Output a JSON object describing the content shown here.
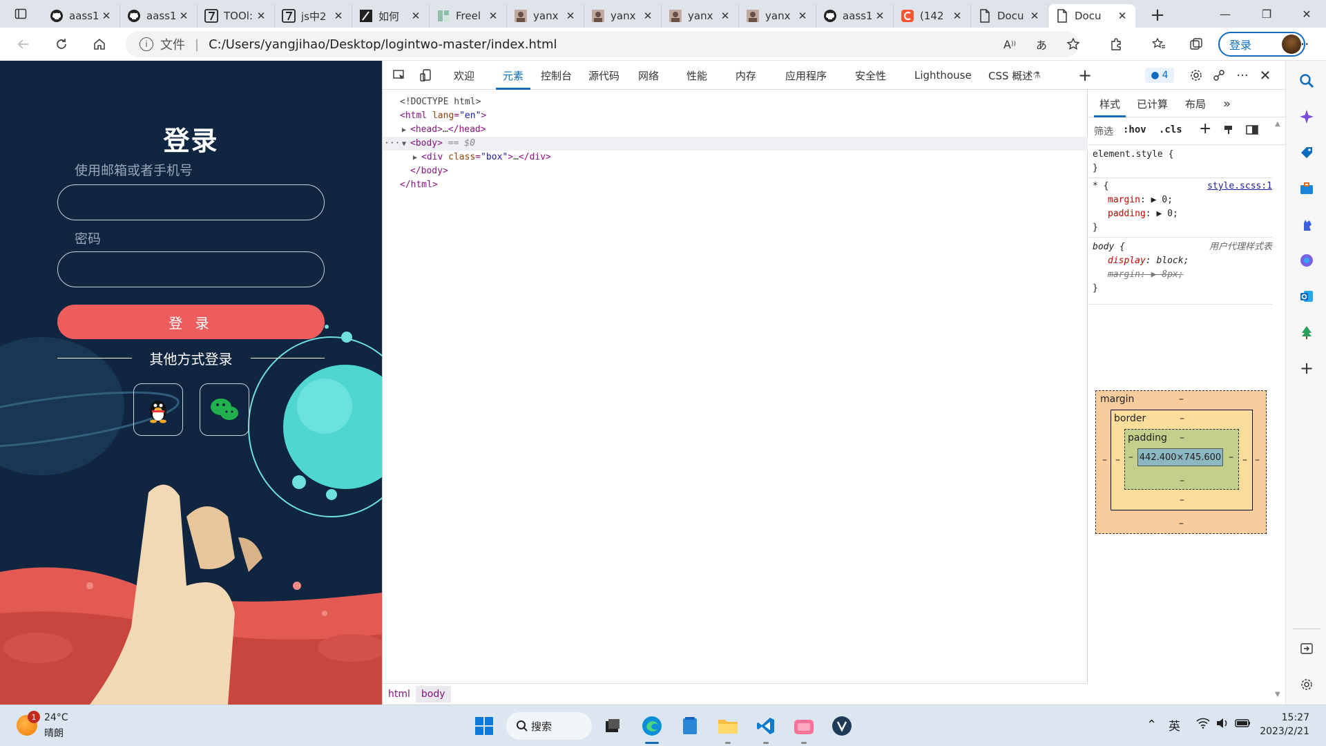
{
  "browser": {
    "tabs": [
      {
        "label": "aass1",
        "icon": "github-icon"
      },
      {
        "label": "aass1",
        "icon": "github-icon"
      },
      {
        "label": "TOOl:",
        "icon": "site-7-icon"
      },
      {
        "label": "js中2",
        "icon": "site-7-icon"
      },
      {
        "label": "如何",
        "icon": "feather-icon"
      },
      {
        "label": "Freel",
        "icon": "freelogo-icon"
      },
      {
        "label": "yanx",
        "icon": "profile-photo-icon"
      },
      {
        "label": "yanx",
        "icon": "profile-photo-icon"
      },
      {
        "label": "yanx",
        "icon": "profile-photo-icon"
      },
      {
        "label": "yanx",
        "icon": "profile-photo-icon"
      },
      {
        "label": "aass1",
        "icon": "github-icon"
      },
      {
        "label": "(142",
        "icon": "csdn-icon"
      },
      {
        "label": "Docu",
        "icon": "document-icon"
      },
      {
        "label": "Docu",
        "icon": "document-icon",
        "active": true
      }
    ],
    "address": {
      "scheme_label": "文件",
      "url": "C:/Users/yangjihao/Desktop/logintwo-master/index.html"
    },
    "profile_button": "登录"
  },
  "login_page": {
    "title": "登录",
    "email_label": "使用邮箱或者手机号",
    "password_label": "密码",
    "submit_label": "登 录",
    "other_login": "其他方式登录"
  },
  "devtools": {
    "tabs": [
      "欢迎",
      "元素",
      "控制台",
      "源代码",
      "网络",
      "性能",
      "内存",
      "应用程序",
      "安全性",
      "Lighthouse",
      "CSS 概述"
    ],
    "selected_tab": "元素",
    "issues_count": "4",
    "dom_lines": {
      "doctype": "<!DOCTYPE html>",
      "html_open_tag": "html",
      "html_lang_attr": "lang",
      "html_lang_value": "\"en\"",
      "head_collapsed": "head",
      "head_ellipsis": "…",
      "body_tag": "body",
      "body_marker": "== $0",
      "div_tag": "div",
      "div_class_attr": "class",
      "div_class_value": "\"box\"",
      "div_ellipsis": "…",
      "body_close": "</body>",
      "html_close": "</html>"
    },
    "breadcrumbs": [
      "html",
      "body"
    ],
    "styles": {
      "tabs": [
        "样式",
        "已计算",
        "布局"
      ],
      "filter_label": "筛选",
      "hov_label": ":hov",
      "cls_label": ".cls",
      "rules": {
        "element_style": "element.style {",
        "element_close": "}",
        "star_selector": "* {",
        "star_source": "style.scss:1",
        "margin_prop": "margin",
        "margin_val": "0;",
        "padding_prop": "padding",
        "padding_val": "0;",
        "star_close": "}",
        "body_selector": "body {",
        "body_source": "用户代理样式表",
        "display_prop": "display",
        "display_val": "block;",
        "body_margin_prop": "margin",
        "body_margin_val": "8px;",
        "body_close": "}"
      },
      "box_model": {
        "margin_label": "margin",
        "border_label": "border",
        "padding_label": "padding",
        "dash": "–",
        "content_size": "442.400×745.600"
      }
    }
  },
  "taskbar": {
    "weather_temp": "24°C",
    "weather_desc": "晴朗",
    "weather_badge": "1",
    "search_label": "搜索",
    "ime": "英",
    "time": "15:27",
    "date": "2023/2/21"
  },
  "colors": {
    "accent": "#0f6cbd",
    "login_bg": "#0f2540",
    "submit_bg": "#ee5d5d"
  }
}
